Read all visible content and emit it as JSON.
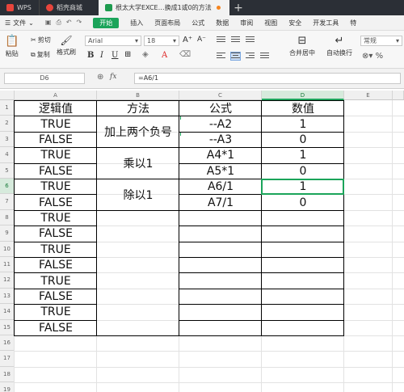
{
  "titlebar": {
    "tabs": [
      {
        "label": "WPS"
      },
      {
        "label": "稻壳商城"
      },
      {
        "label": "根太大学EXCE…换成1或0的方法"
      }
    ]
  },
  "menubar": {
    "file": "文件",
    "start": "开始",
    "items": [
      "插入",
      "页面布局",
      "公式",
      "数据",
      "审阅",
      "视图",
      "安全",
      "开发工具",
      "特"
    ]
  },
  "ribbon": {
    "paste": "粘贴",
    "cut": "剪切",
    "copy": "复制",
    "format_painter": "格式刷",
    "font_name": "Arial",
    "font_size": "18",
    "merge_center": "合并居中",
    "wrap": "自动换行",
    "number_format": "常规"
  },
  "formula_bar": {
    "name_box": "D6",
    "fx": "fx",
    "formula": "=A6/1"
  },
  "columns": [
    "A",
    "B",
    "C",
    "D",
    "E"
  ],
  "rows": [
    "1",
    "2",
    "3",
    "4",
    "5",
    "6",
    "7",
    "8",
    "9",
    "10",
    "11",
    "12",
    "13",
    "14",
    "15",
    "16",
    "17",
    "18",
    "19"
  ],
  "sheet": {
    "headers": {
      "A": "逻辑值",
      "B": "方法",
      "C": "公式",
      "D": "数值"
    },
    "col_a": [
      "TRUE",
      "FALSE",
      "TRUE",
      "FALSE",
      "TRUE",
      "FALSE",
      "TRUE",
      "FALSE",
      "TRUE",
      "FALSE",
      "TRUE",
      "FALSE",
      "TRUE",
      "FALSE"
    ],
    "methods": [
      "加上两个负号",
      "乘以1",
      "除以1"
    ],
    "formulas": [
      "--A2",
      "--A3",
      "A4*1",
      "A5*1",
      "A6/1",
      "A7/1"
    ],
    "values": [
      "1",
      "0",
      "1",
      "0",
      "1",
      "0"
    ]
  },
  "selected_cell": "D6",
  "accent": "#1ba45a"
}
